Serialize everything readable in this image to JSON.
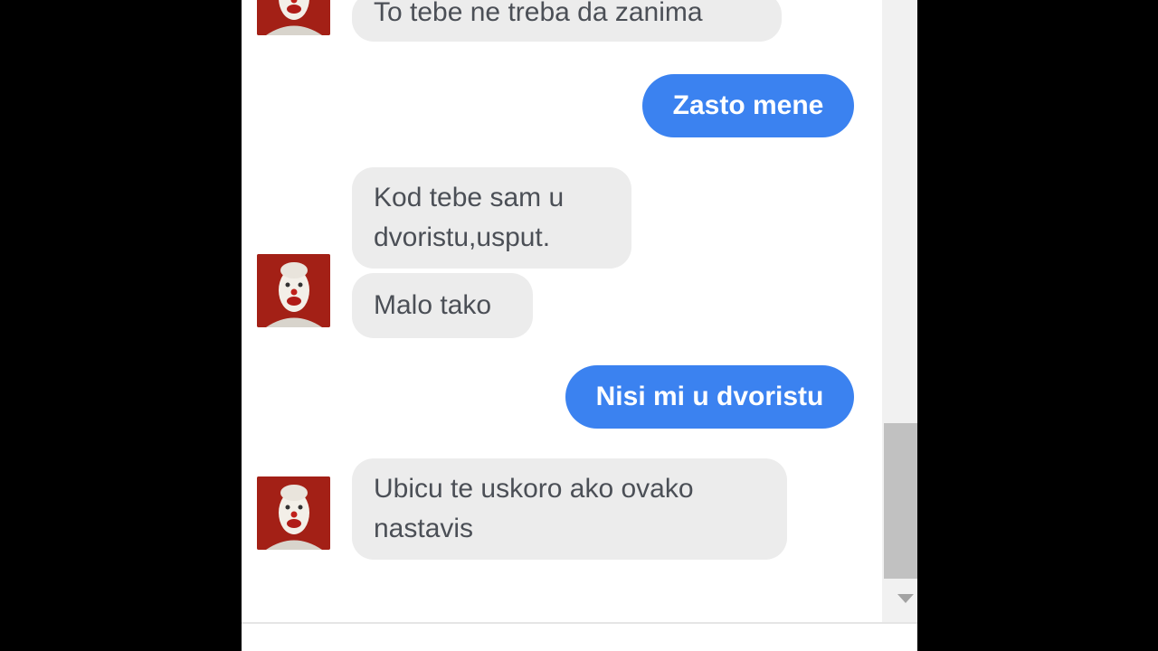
{
  "conversation": {
    "messages": [
      {
        "sender": "contact",
        "text": "To tebe ne treba da zanima"
      },
      {
        "sender": "me",
        "text": "Zasto mene"
      },
      {
        "sender": "contact",
        "text_lines": [
          "Kod tebe sam u",
          "dvoristu,usput."
        ]
      },
      {
        "sender": "contact",
        "text": "Malo tako"
      },
      {
        "sender": "me",
        "text": "Nisi mi u dvoristu"
      },
      {
        "sender": "contact",
        "text_lines": [
          "Ubicu te uskoro ako ovako",
          "nastavis"
        ]
      }
    ],
    "contact_avatar_icon": "clown-avatar-icon"
  },
  "colors": {
    "outgoing_bubble": "#3b82f0",
    "incoming_bubble": "#ececec",
    "incoming_text": "#4b4f56",
    "background": "#ffffff"
  }
}
